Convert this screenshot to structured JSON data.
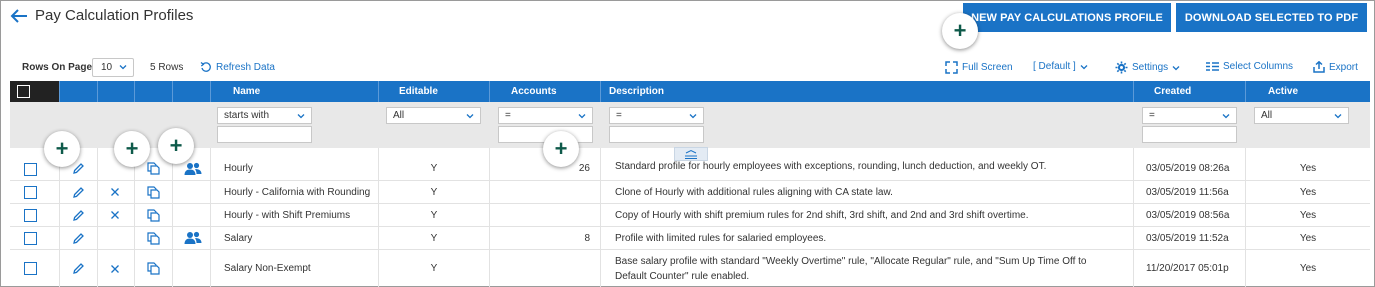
{
  "page": {
    "title": "Pay Calculation Profiles",
    "new_button": "NEW PAY CALCULATIONS PROFILE",
    "download_button": "DOWNLOAD SELECTED TO PDF",
    "plus_symbol": "+"
  },
  "toolbar": {
    "rows_on_page_label": "Rows On Page",
    "rows_on_page_value": "10",
    "rows_count": "5 Rows",
    "refresh": "Refresh Data",
    "full_screen": "Full Screen",
    "default_view": "[ Default ]",
    "settings": "Settings",
    "select_columns": "Select Columns",
    "export": "Export"
  },
  "columns": {
    "name": "Name",
    "editable": "Editable",
    "accounts": "Accounts",
    "description": "Description",
    "created": "Created",
    "active": "Active"
  },
  "filters": {
    "name": "starts with",
    "editable": "All",
    "accounts": "=",
    "description": "=",
    "created": "=",
    "active": "All"
  },
  "rows": [
    {
      "name": "Hourly",
      "editable": "Y",
      "accounts": "26",
      "description": "Standard profile for hourly employees with exceptions, rounding, lunch deduction, and weekly OT.",
      "created": "03/05/2019 08:26a",
      "active": "Yes"
    },
    {
      "name": "Hourly - California with Rounding",
      "editable": "Y",
      "accounts": "",
      "description": "Clone of Hourly with additional rules aligning with CA state law.",
      "created": "03/05/2019 11:56a",
      "active": "Yes"
    },
    {
      "name": "Hourly - with Shift Premiums",
      "editable": "Y",
      "accounts": "",
      "description": "Copy of Hourly with shift premium rules for 2nd shift, 3rd shift, and 2nd and 3rd shift overtime.",
      "created": "03/05/2019 08:56a",
      "active": "Yes"
    },
    {
      "name": "Salary",
      "editable": "Y",
      "accounts": "8",
      "description": "Profile with limited rules for salaried employees.",
      "created": "03/05/2019 11:52a",
      "active": "Yes"
    },
    {
      "name": "Salary Non-Exempt",
      "editable": "Y",
      "accounts": "",
      "description": "Base salary profile with standard \"Weekly Overtime\" rule, \"Allocate Regular\" rule, and \"Sum Up Time Off to Default Counter\" rule enabled.",
      "created": "11/20/2017 05:01p",
      "active": "Yes"
    }
  ],
  "colors": {
    "accent": "#1a73c6",
    "badge_plus": "#0e5a4a"
  }
}
